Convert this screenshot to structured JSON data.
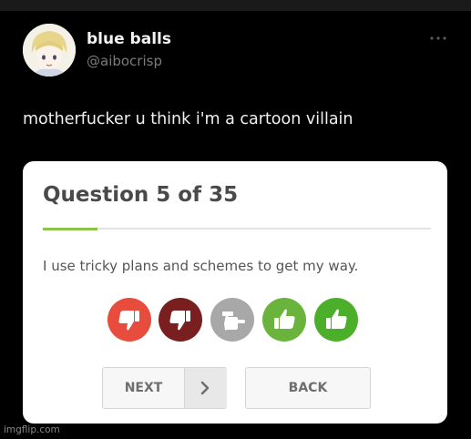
{
  "tweet": {
    "display_name": "blue balls",
    "handle": "@aibocrisp",
    "text": "motherfucker u think i'm a cartoon villain",
    "more_icon": "ellipsis-icon"
  },
  "quiz": {
    "title": "Question 5 of 35",
    "progress": 0.14,
    "statement": "I use tricky plans and schemes to get my way.",
    "ratings": [
      {
        "name": "strongly-disagree",
        "icon": "thumbs-down-icon",
        "color": "#e74c3c"
      },
      {
        "name": "disagree",
        "icon": "thumbs-down-icon",
        "color": "#7a1f1f"
      },
      {
        "name": "neutral",
        "icon": "thumbs-sideways-icon",
        "color": "#a8a8a8"
      },
      {
        "name": "agree",
        "icon": "thumbs-up-icon",
        "color": "#6ab43e"
      },
      {
        "name": "strongly-agree",
        "icon": "thumbs-up-icon",
        "color": "#4caf2a"
      }
    ],
    "next_label": "NEXT",
    "back_label": "BACK"
  },
  "watermark": "imgflip.com",
  "colors": {
    "accent_green": "#8bc34a",
    "background": "#000000",
    "card": "#ffffff"
  }
}
